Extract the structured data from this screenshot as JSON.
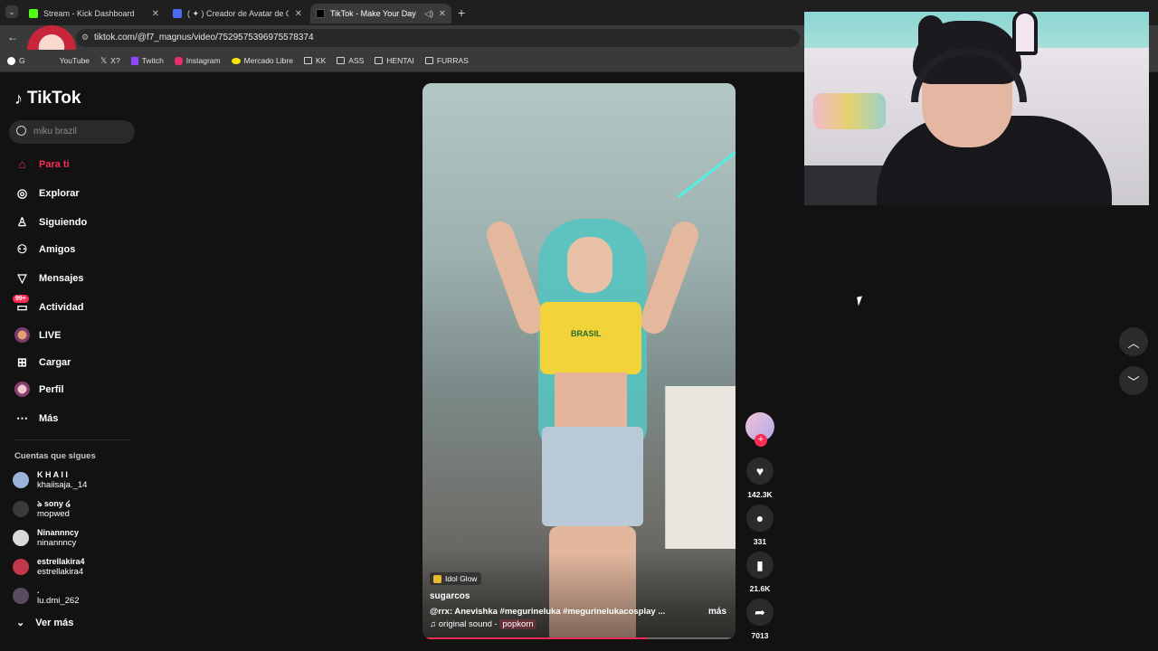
{
  "browser": {
    "tabs": [
      {
        "title": "Stream - Kick Dashboard",
        "color": "#53fc18"
      },
      {
        "title": "( ✦ ) Creador de Avatar de Cata",
        "color": "#4a6cf7"
      },
      {
        "title": "TikTok - Make Your Day",
        "color": "#111111"
      }
    ],
    "url": "tiktok.com/@f7_magnus/video/7529575396975578374",
    "bookmarks": [
      "G",
      "YouTube",
      "X?",
      "Twitch",
      "Instagram",
      "Mercado Libre",
      "KK",
      "ASS",
      "HENTAI",
      "FURRAS"
    ]
  },
  "sidebar": {
    "logo": "TikTok",
    "search_placeholder": "miku brazil",
    "nav": [
      {
        "label": "Para ti",
        "icon": "home-icon",
        "glyph": "⌂"
      },
      {
        "label": "Explorar",
        "icon": "compass-icon",
        "glyph": "◎"
      },
      {
        "label": "Siguiendo",
        "icon": "following-icon",
        "glyph": "♙"
      },
      {
        "label": "Amigos",
        "icon": "friends-icon",
        "glyph": "⚇"
      },
      {
        "label": "Mensajes",
        "icon": "send-icon",
        "glyph": "▽"
      },
      {
        "label": "Actividad",
        "icon": "activity-icon",
        "glyph": "▭",
        "badge": "99+"
      },
      {
        "label": "LIVE",
        "icon": "live-icon",
        "glyph": "●"
      },
      {
        "label": "Cargar",
        "icon": "upload-icon",
        "glyph": "⊞"
      },
      {
        "label": "Perfil",
        "icon": "profile-icon",
        "glyph": "●"
      },
      {
        "label": "Más",
        "icon": "more-icon",
        "glyph": "⋯"
      }
    ],
    "following_title": "Cuentas que sigues",
    "following": [
      {
        "name": "K H A I I",
        "handle": "khaiisaja._14",
        "color": "#9bb3d9"
      },
      {
        "name": "ঌ sony ໒",
        "handle": "mopwed",
        "color": "#3a3a3a"
      },
      {
        "name": "Ninannncy",
        "handle": "ninannncy",
        "color": "#d9d9d9"
      },
      {
        "name": "estrellakira4",
        "handle": "estrellakira4",
        "color": "#c0394a"
      },
      {
        "name": ".",
        "handle": "lu.dmi_262",
        "color": "#5a4a5f"
      }
    ],
    "see_more": "Ver más"
  },
  "video": {
    "shirt_text": "BRASIL",
    "effect_tag": "Idol Glow",
    "username": "sugarcos",
    "description": "@rrx: Anevishka #megurineluka #megurinelukacosplay ...",
    "more": "más",
    "sound_prefix": "♫ original sound -",
    "sound_name": "popkorn",
    "progress": 0.72
  },
  "actions": {
    "likes": "142.3K",
    "comments": "331",
    "saves": "21.6K",
    "shares": "7013"
  },
  "colors": {
    "accent": "#fe2c55",
    "background": "#121212"
  }
}
